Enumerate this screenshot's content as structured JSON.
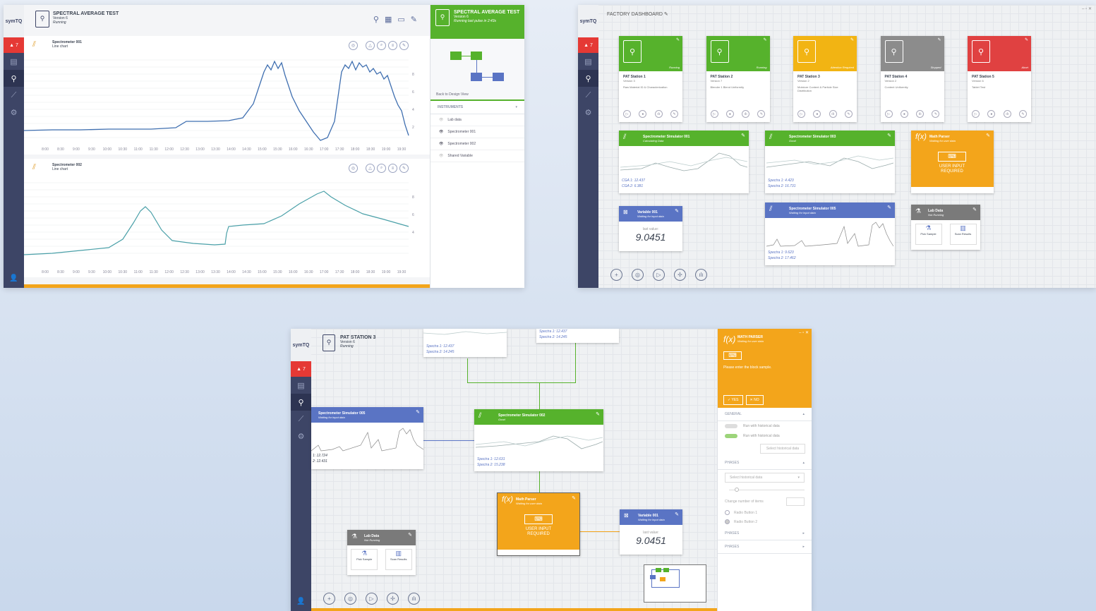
{
  "nav": {
    "logo": "symTQ",
    "alert_count": "7"
  },
  "s1": {
    "title": "SPECTRAL AVERAGE TEST",
    "version": "Version 6",
    "status": "Running",
    "chart1": {
      "title": "Spectrometer 001",
      "type": "Line chart",
      "x_ticks": [
        "8:00",
        "8:30",
        "9:00",
        "9:30",
        "10:00",
        "10:30",
        "11:00",
        "11:30",
        "12:00",
        "12:30",
        "13:00",
        "13:30",
        "14:00",
        "14:30",
        "15:00",
        "15:30",
        "16:00",
        "16:30",
        "17:00",
        "17:30",
        "18:00",
        "18:30",
        "19:00",
        "19:30"
      ],
      "y_ticks": [
        "8",
        "6",
        "4",
        "2"
      ]
    },
    "chart2": {
      "title": "Spectrometer 002",
      "type": "Line chart",
      "x_ticks": [
        "8:00",
        "8:30",
        "9:00",
        "9:30",
        "10:00",
        "10:30",
        "11:00",
        "11:30",
        "12:00",
        "12:30",
        "13:00",
        "13:30",
        "14:00",
        "14:30",
        "15:00",
        "15:30",
        "16:00",
        "16:30",
        "17:00",
        "17:30",
        "18:00",
        "18:30",
        "19:00",
        "19:30"
      ],
      "y_ticks": [
        "8",
        "6",
        "4"
      ]
    },
    "panel": {
      "title": "SPECTRAL AVERAGE TEST",
      "version": "Version 6",
      "status": "Running",
      "last": "last pulse in 2:43s",
      "design_label": "Back to Design View",
      "section": "INSTRUMENTS",
      "instruments": [
        "Lab data",
        "Spectrometer 001",
        "Spectrometer 002",
        "Shared Variable"
      ]
    }
  },
  "s2": {
    "title": "FACTORY DASHBOARD",
    "stations": [
      {
        "name": "PAT Station 1",
        "version": "Version 3",
        "desc": "Raw Material ID & Characterization",
        "status": "Running",
        "color": "#56b22c"
      },
      {
        "name": "PAT Station 2",
        "version": "Version 7",
        "desc": "Blender 1 Blend Uniformity",
        "status": "Running",
        "color": "#56b22c"
      },
      {
        "name": "PAT Station 3",
        "version": "Version 2",
        "desc": "Moisture Content & Particle Size Distribution",
        "status": "Attention Required",
        "color": "#f2b413"
      },
      {
        "name": "PAT Station 4",
        "version": "Version 2",
        "desc": "Content Uniformity",
        "status": "Stopped",
        "color": "#8c8c8c"
      },
      {
        "name": "PAT Station 5",
        "version": "Version 6",
        "desc": "Tablet Test",
        "status": "Abort",
        "color": "#e04141"
      }
    ],
    "sim001": {
      "title": "Spectrometer Simulator 001",
      "sub": "Calculating Data",
      "v1": "CGA 1: 12.437",
      "v2": "CGA 2: 6.381"
    },
    "sim003": {
      "title": "Spectrometer Simulator 003",
      "sub": "Good",
      "v1": "Spectra 1: 4.423",
      "v2": "Spectra 2: 16.731"
    },
    "sim005": {
      "title": "Spectrometer Simulator 005",
      "sub": "Waiting for input data",
      "v1": "Spectra 1: 9.623",
      "v2": "Spectra 2: 17.462"
    },
    "math": {
      "title": "Math Parser",
      "sub": "Waiting for user data",
      "ui": "USER INPUT REQUIRED"
    },
    "var": {
      "title": "Variable 001",
      "sub": "Waiting for input data",
      "label": "last value:",
      "value": "9.0451"
    },
    "lab": {
      "title": "Lab Data",
      "sub": "Not Running",
      "b1": "Pick Sample",
      "b2": "Scan Results"
    }
  },
  "s3": {
    "title": "PAT STATION 3",
    "version": "Version 6",
    "status": "Running",
    "top1": {
      "v1": "Spectra 1: 12.437",
      "v2": "Spectra 2: 14.245"
    },
    "top2": {
      "v1": "Spectra 1: 12.437",
      "v2": "Spectra 2: 14.245"
    },
    "sim005": {
      "title": "Spectrometer Simulator 005",
      "sub": "Waiting for input data",
      "v1": "1: 12.724",
      "v2": "2: 12.431"
    },
    "sim002": {
      "title": "Spectrometer Simulator 002",
      "sub": "Good",
      "v1": "Spectra 1: 12.631",
      "v2": "Spectra 2: 15.238"
    },
    "math": {
      "title": "Math Parser",
      "sub": "Waiting for user data",
      "ui": "USER INPUT REQUIRED"
    },
    "var": {
      "title": "Variable 001",
      "sub": "Waiting for input data",
      "label": "last value:",
      "value": "9.0451"
    },
    "lab": {
      "title": "Lab Data",
      "sub": "Not Running",
      "b1": "Pick Sample",
      "b2": "Scan Results"
    },
    "panel": {
      "title": "MATH PARSER",
      "sub": "Waiting for user data",
      "prompt": "Please enter the block sample.",
      "yes": "YES",
      "no": "NO",
      "general": "GENERAL",
      "opt1": "Run with historical data",
      "opt2": "Run with historical data",
      "select_btn": "Select historical data",
      "phases": "PHASES",
      "select_placeholder": "Select historical data",
      "change": "Change number of items",
      "radio1": "Radio Button 1",
      "radio2": "Radio Button 2",
      "phases2": "PHASES",
      "phases3": "PHASES"
    }
  }
}
